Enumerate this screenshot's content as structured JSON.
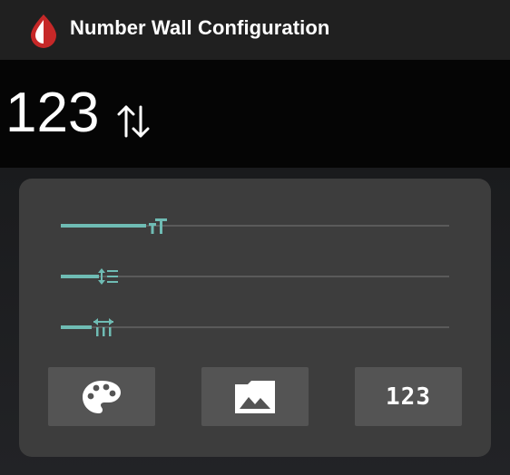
{
  "window": {
    "title": "Number Wall Configuration",
    "app_icon": "drop-icon",
    "accent": "#c62828"
  },
  "preview": {
    "number": "123",
    "sort_icon": "sort-arrows-icon"
  },
  "sliders": [
    {
      "name": "text-size",
      "icon": "text-size-icon",
      "value": 0.22
    },
    {
      "name": "line-spacing",
      "icon": "line-spacing-icon",
      "value": 0.1
    },
    {
      "name": "column-spacing",
      "icon": "column-spacing-icon",
      "value": 0.07
    }
  ],
  "buttons": {
    "color": {
      "icon": "palette-icon"
    },
    "background": {
      "icon": "image-icon"
    },
    "number": {
      "label": "123"
    }
  },
  "colors": {
    "slider_fill": "#6fbcb4",
    "slider_track": "#5a5a5a",
    "panel": "#3d3d3d",
    "button": "#545454"
  }
}
